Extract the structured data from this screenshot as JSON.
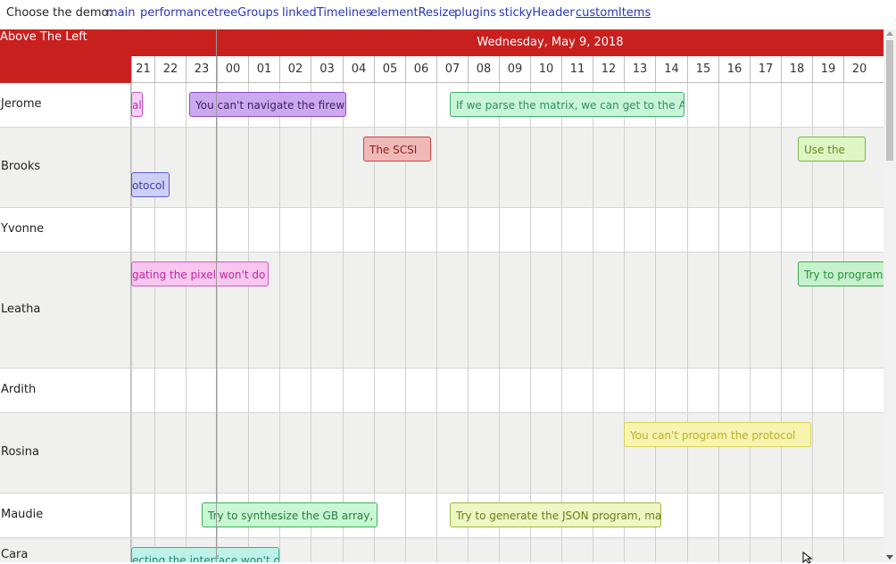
{
  "nav": {
    "label": "Choose the demo:",
    "links": [
      "main",
      "performance",
      "treeGroups",
      "linkedTimelines",
      "elementResize",
      "plugins",
      "stickyHeader",
      "customItems"
    ],
    "active": "customItems"
  },
  "sidebar_header": "Above The Left",
  "date_header": "Wednesday, May 9, 2018",
  "hours": [
    "21",
    "22",
    "23",
    "00",
    "01",
    "02",
    "03",
    "04",
    "05",
    "06",
    "07",
    "08",
    "09",
    "10",
    "11",
    "12",
    "13",
    "14",
    "15",
    "16",
    "17",
    "18",
    "19",
    "20"
  ],
  "groups": [
    "Jerome",
    "Brooks",
    "Yvonne",
    "Leatha",
    "Ardith",
    "Rosina",
    "Maudie",
    "Cara"
  ],
  "items": [
    {
      "text": "al",
      "color": "#b82db8",
      "bg": "#f3d3f3",
      "border": "#c44cc4"
    },
    {
      "text": "You can't navigate the firewall",
      "color": "#3b2060",
      "bg": "#cda8ee",
      "border": "#8a4cc4"
    },
    {
      "text": "If we parse the matrix, we can get to the AGP",
      "color": "#2f8f5a",
      "bg": "#c8f5d8",
      "border": "#3fae6d"
    },
    {
      "text": "The SCSI",
      "color": "#8a2020",
      "bg": "#f1b8b8",
      "border": "#c84242"
    },
    {
      "text": "Use the",
      "color": "#5f8a1e",
      "bg": "#def5c4",
      "border": "#7cb640"
    },
    {
      "text": "otocol",
      "color": "#3a3aa8",
      "bg": "#cfcff5",
      "border": "#5c5cc8"
    },
    {
      "text": "gating the pixel won't do",
      "color": "#c0269e",
      "bg": "#f7c7ef",
      "border": "#d456bf"
    },
    {
      "text": "Try to program th",
      "color": "#2b8f3a",
      "bg": "#c6f1cd",
      "border": "#3cab4d"
    },
    {
      "text": "You can't program the protocol",
      "color": "#b7b02a",
      "bg": "#f7f4b0",
      "border": "#d8d256"
    },
    {
      "text": "Try to synthesize the GB array,",
      "color": "#2a7a3e",
      "bg": "#c8f7d4",
      "border": "#3fae5a"
    },
    {
      "text": "Try to generate the JSON program, maybe",
      "color": "#6b7a1a",
      "bg": "#eef7c4",
      "border": "#9bb640"
    },
    {
      "text": "ecting the interface won't do",
      "color": "#1a8a7a",
      "bg": "#bff2e6",
      "border": "#2db39c"
    }
  ],
  "colors": {
    "header_red": "#c8201f",
    "row_alt": "#f0f0ef",
    "link": "#2a36b8"
  },
  "icons": {
    "cursor": "mouse-pointer-icon"
  }
}
